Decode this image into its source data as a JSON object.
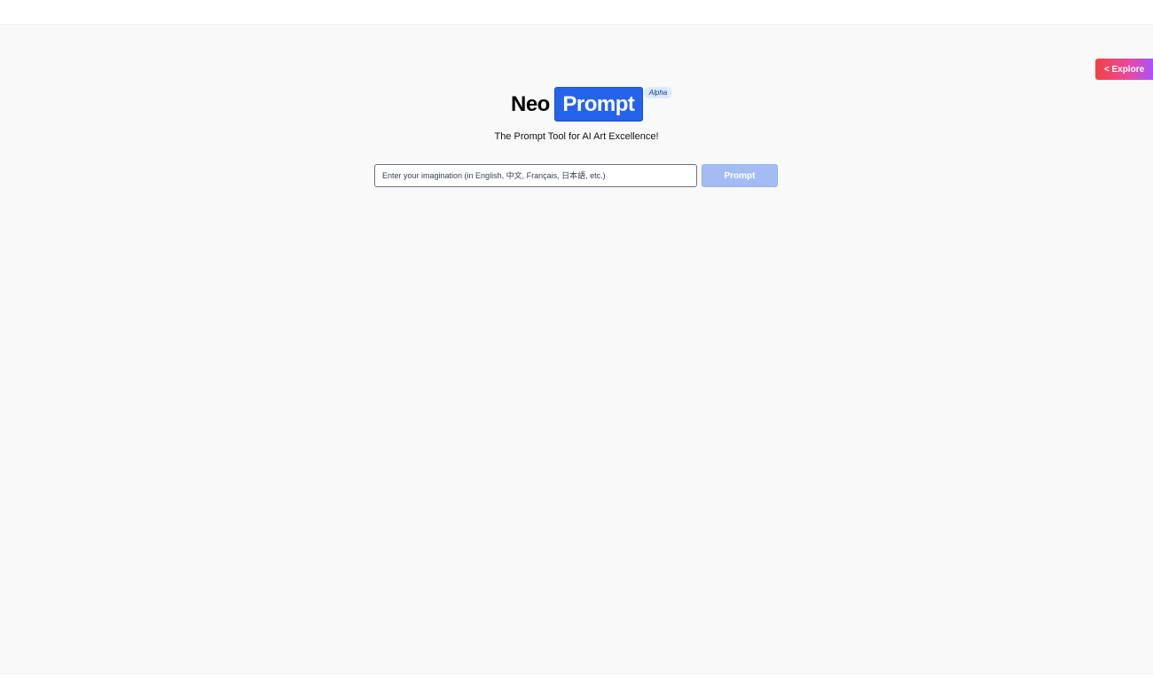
{
  "header": {
    "explore_label": "< Explore"
  },
  "logo": {
    "word_neo": "Neo",
    "word_prompt": "Prompt",
    "badge": "Alpha",
    "accent_color": "#2563eb"
  },
  "hero": {
    "subtitle": "The Prompt Tool for AI Art Excellence!"
  },
  "search": {
    "placeholder": "Enter your imagination (in English, 中文, Français, 日本語, etc.)",
    "value": "",
    "submit_label": "Prompt"
  },
  "colors": {
    "background": "#f9f9f9",
    "explore_gradient": [
      "#ef4444",
      "#ec4899",
      "#a855f7"
    ],
    "button_disabled": "#a3bdf4"
  }
}
